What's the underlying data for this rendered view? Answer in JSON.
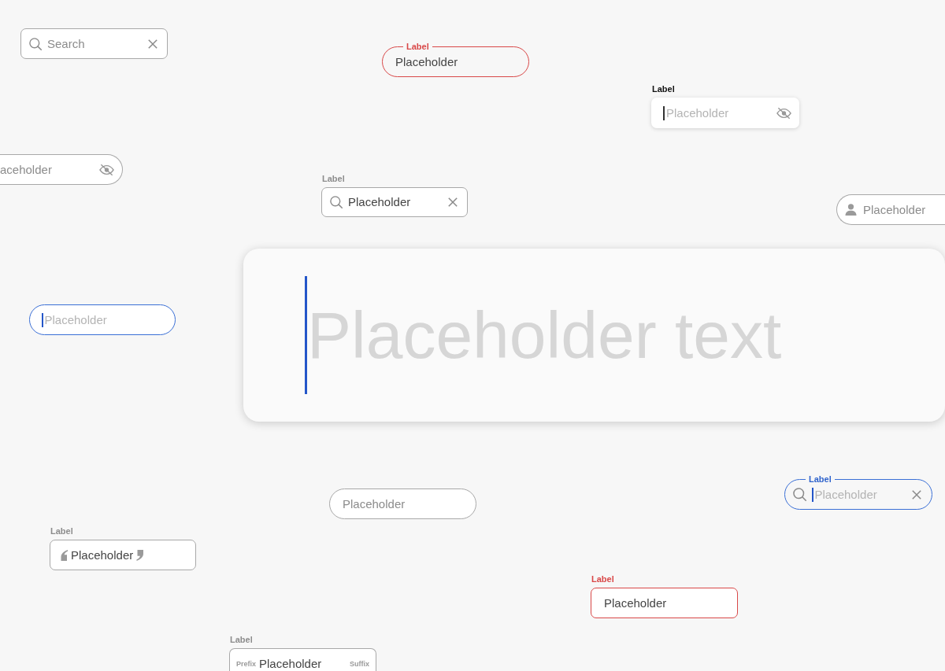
{
  "fields": [
    {
      "kind": "search",
      "focused": false,
      "error": false,
      "placeholder": "Search"
    },
    {
      "kind": "text",
      "focused": false,
      "error": true,
      "label": "Label",
      "value": "Placeholder"
    },
    {
      "kind": "password",
      "focused": true,
      "error": false,
      "label": "Label",
      "placeholder": "Placeholder"
    },
    {
      "kind": "password",
      "focused": false,
      "error": false,
      "placeholder": "aceholder"
    },
    {
      "kind": "search",
      "focused": false,
      "error": false,
      "label": "Label",
      "value": "Placeholder"
    },
    {
      "kind": "user",
      "focused": false,
      "error": false,
      "placeholder": "Placeholder"
    },
    {
      "kind": "text",
      "focused": true,
      "error": false,
      "placeholder": "Placeholder text"
    },
    {
      "kind": "text",
      "focused": true,
      "error": false,
      "placeholder": "Placeholder"
    },
    {
      "kind": "search",
      "focused": true,
      "error": false,
      "label": "Label",
      "placeholder": "Placeholder"
    },
    {
      "kind": "text",
      "focused": false,
      "error": false,
      "placeholder": "Placeholder"
    },
    {
      "kind": "quote",
      "focused": false,
      "error": false,
      "label": "Label",
      "value": "Placeholder"
    },
    {
      "kind": "text",
      "focused": false,
      "error": true,
      "label": "Label",
      "value": "Placeholder"
    },
    {
      "kind": "affix",
      "focused": false,
      "error": false,
      "label": "Label",
      "prefix": "Prefix",
      "value": "Placeholder",
      "suffix": "Suffix"
    }
  ]
}
